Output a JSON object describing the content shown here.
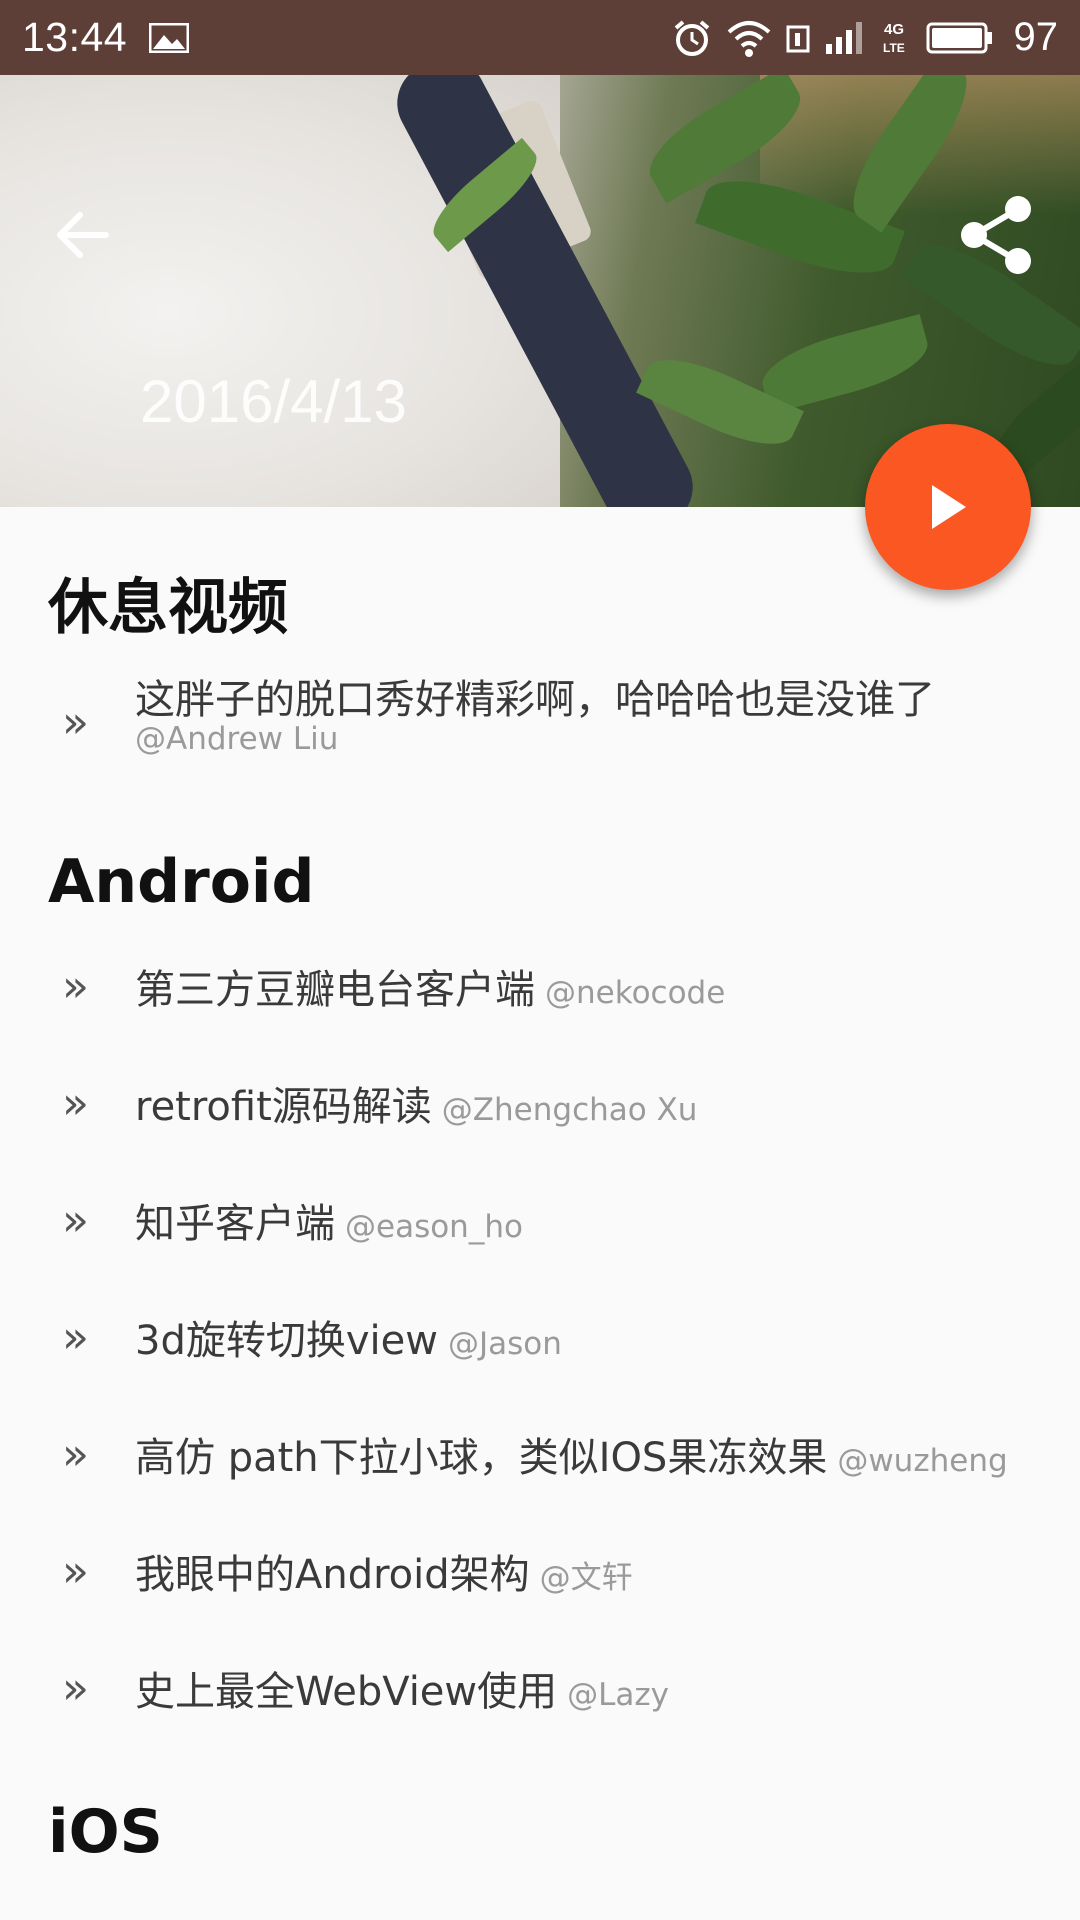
{
  "status_bar": {
    "time": "13:44",
    "battery": "97",
    "icons": [
      "image-icon",
      "alarm-icon",
      "wifi-icon",
      "sim-icon",
      "signal-icon",
      "4g-lte-icon",
      "battery-icon"
    ]
  },
  "header": {
    "date": "2016/4/13",
    "back_icon": "arrow-back-icon",
    "share_icon": "share-icon"
  },
  "fab": {
    "icon": "play-icon",
    "color": "#fb5722"
  },
  "sections": [
    {
      "title": "休息视频",
      "items": [
        {
          "title": "这胖子的脱口秀好精彩啊，哈哈哈也是没谁了",
          "author": "@Andrew Liu"
        }
      ]
    },
    {
      "title": "Android",
      "items": [
        {
          "title": "第三方豆瓣电台客户端",
          "author": "@nekocode"
        },
        {
          "title": "retrofit源码解读",
          "author": "@Zhengchao Xu"
        },
        {
          "title": "知乎客户端",
          "author": "@eason_ho"
        },
        {
          "title": "3d旋转切换view",
          "author": "@Jason"
        },
        {
          "title": "高仿 path下拉小球，类似IOS果冻效果",
          "author": "@wuzheng"
        },
        {
          "title": "我眼中的Android架构",
          "author": "@文轩"
        },
        {
          "title": "史上最全WebView使用",
          "author": "@Lazy"
        }
      ]
    },
    {
      "title": "iOS",
      "items": []
    }
  ],
  "bullet": "»",
  "colors": {
    "status_bar": "#5d3f38",
    "accent": "#fb5722",
    "background": "#fafafa"
  }
}
